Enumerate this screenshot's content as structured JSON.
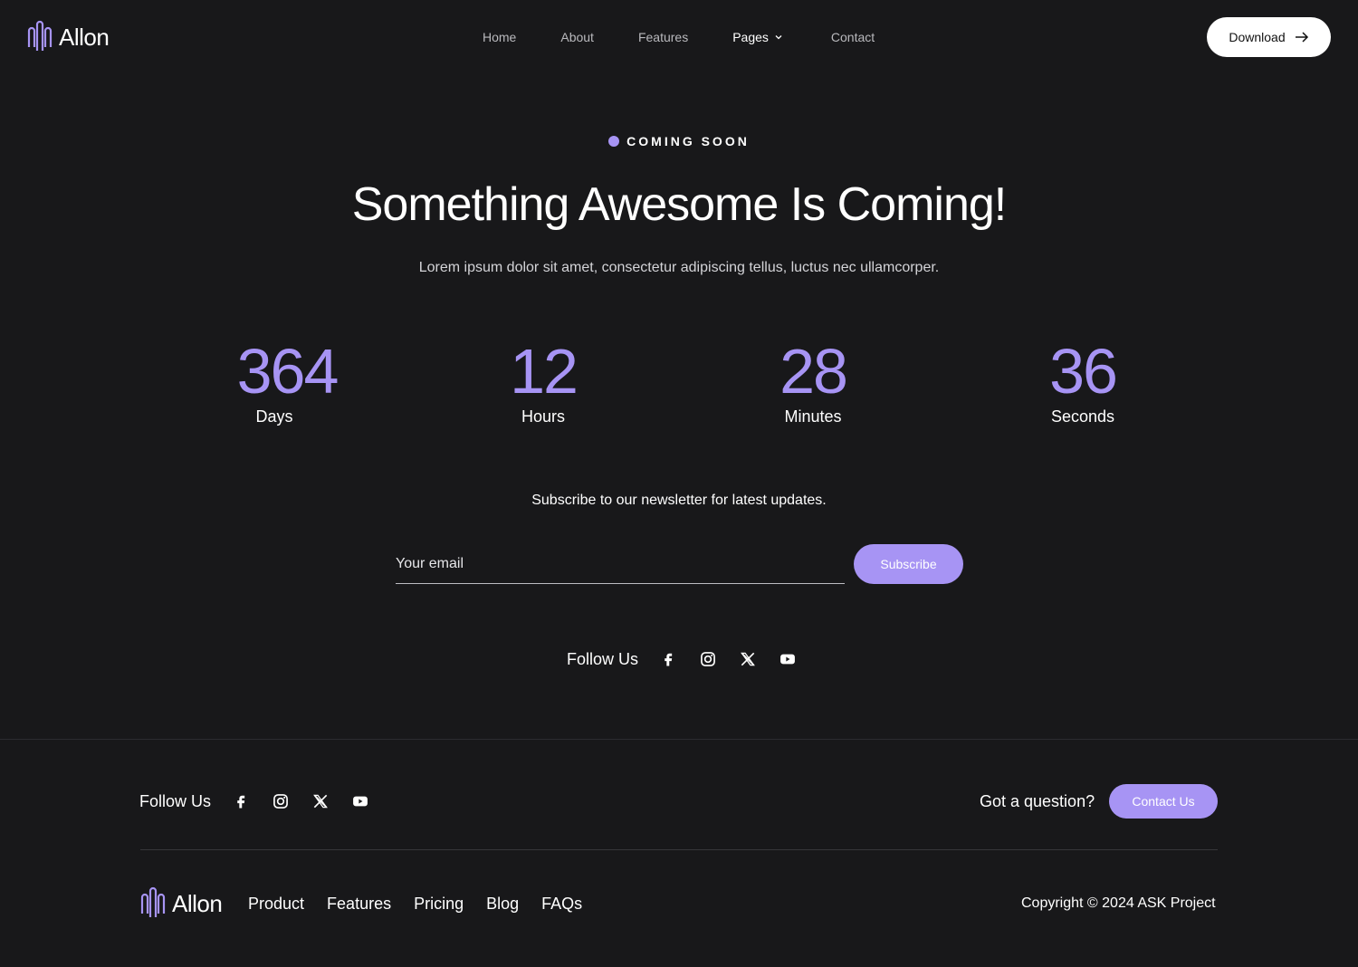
{
  "brand": {
    "name": "Allon",
    "accent_color": "#a794f4",
    "background": "#18181a"
  },
  "header": {
    "nav": [
      {
        "label": "Home"
      },
      {
        "label": "About"
      },
      {
        "label": "Features"
      },
      {
        "label": "Pages",
        "has_dropdown": true,
        "active": true
      },
      {
        "label": "Contact"
      }
    ],
    "download_label": "Download"
  },
  "hero": {
    "badge": "COMING SOON",
    "title": "Something Awesome Is Coming!",
    "subtitle": "Lorem ipsum dolor sit amet, consectetur adipiscing tellus, luctus nec ullamcorper."
  },
  "countdown": [
    {
      "value": "364",
      "label": "Days"
    },
    {
      "value": "12",
      "label": "Hours"
    },
    {
      "value": "28",
      "label": "Minutes"
    },
    {
      "value": "36",
      "label": "Seconds"
    }
  ],
  "newsletter": {
    "text": "Subscribe to our newsletter for latest updates.",
    "email_placeholder": "Your email",
    "subscribe_label": "Subscribe"
  },
  "social": {
    "label": "Follow Us",
    "icons": [
      "facebook-icon",
      "instagram-icon",
      "x-icon",
      "youtube-icon"
    ]
  },
  "footer": {
    "follow_label": "Follow Us",
    "question": "Got a question?",
    "contact_label": "Contact Us",
    "links": [
      "Product",
      "Features",
      "Pricing",
      "Blog",
      "FAQs"
    ],
    "copyright": "Copyright © 2024 ASK Project"
  }
}
